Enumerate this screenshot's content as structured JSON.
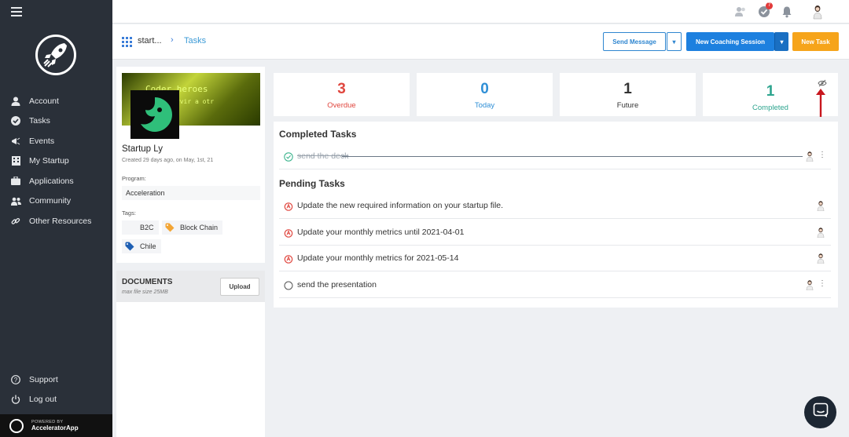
{
  "sidebar": {
    "items": [
      {
        "label": "Account",
        "icon": "person-icon"
      },
      {
        "label": "Tasks",
        "icon": "check-circle-icon"
      },
      {
        "label": "Events",
        "icon": "megaphone-icon"
      },
      {
        "label": "My Startup",
        "icon": "building-icon"
      },
      {
        "label": "Applications",
        "icon": "briefcase-icon"
      },
      {
        "label": "Community",
        "icon": "users-icon"
      },
      {
        "label": "Other Resources",
        "icon": "link-icon"
      }
    ],
    "bottom": [
      {
        "label": "Support",
        "icon": "help-icon"
      },
      {
        "label": "Log out",
        "icon": "power-icon"
      }
    ],
    "powered_by": "POWERED BY",
    "brand": "AcceleratorApp"
  },
  "topbar": {
    "notification_count": "7"
  },
  "header": {
    "breadcrumb_root": "start...",
    "breadcrumb_current": "Tasks",
    "send_message": "Send Message",
    "new_coaching_session": "New Coaching Session",
    "new_task": "New Task"
  },
  "profile": {
    "banner_text_1": "Coder heroes",
    "banner_text_2": "PHP Servir a otr",
    "name": "Startup Ly",
    "created": "Created 29 days ago, on May, 1st, 21",
    "program_label": "Program:",
    "program_value": "Acceleration",
    "tags_label": "Tags:",
    "tags": [
      "B2C",
      "Block Chain",
      "Chile"
    ]
  },
  "documents": {
    "title": "DOCUMENTS",
    "subtitle": "max file size 25MB",
    "upload": "Upload"
  },
  "stats": [
    {
      "value": "3",
      "label": "Overdue",
      "color": "#e0473f"
    },
    {
      "value": "0",
      "label": "Today",
      "color": "#2f8fd6"
    },
    {
      "value": "1",
      "label": "Future",
      "color": "#333333"
    },
    {
      "value": "1",
      "label": "Completed",
      "color": "#2ea58f"
    }
  ],
  "tasks": {
    "completed_title": "Completed Tasks",
    "completed": [
      "send the deck"
    ],
    "pending_title": "Pending Tasks",
    "pending": [
      {
        "text": "Update the new required information on your startup file.",
        "status": "overdue"
      },
      {
        "text": "Update your monthly metrics until 2021-04-01",
        "status": "overdue"
      },
      {
        "text": "Update your monthly metrics for 2021-05-14",
        "status": "overdue"
      },
      {
        "text": "send the presentation",
        "status": "open"
      }
    ]
  }
}
